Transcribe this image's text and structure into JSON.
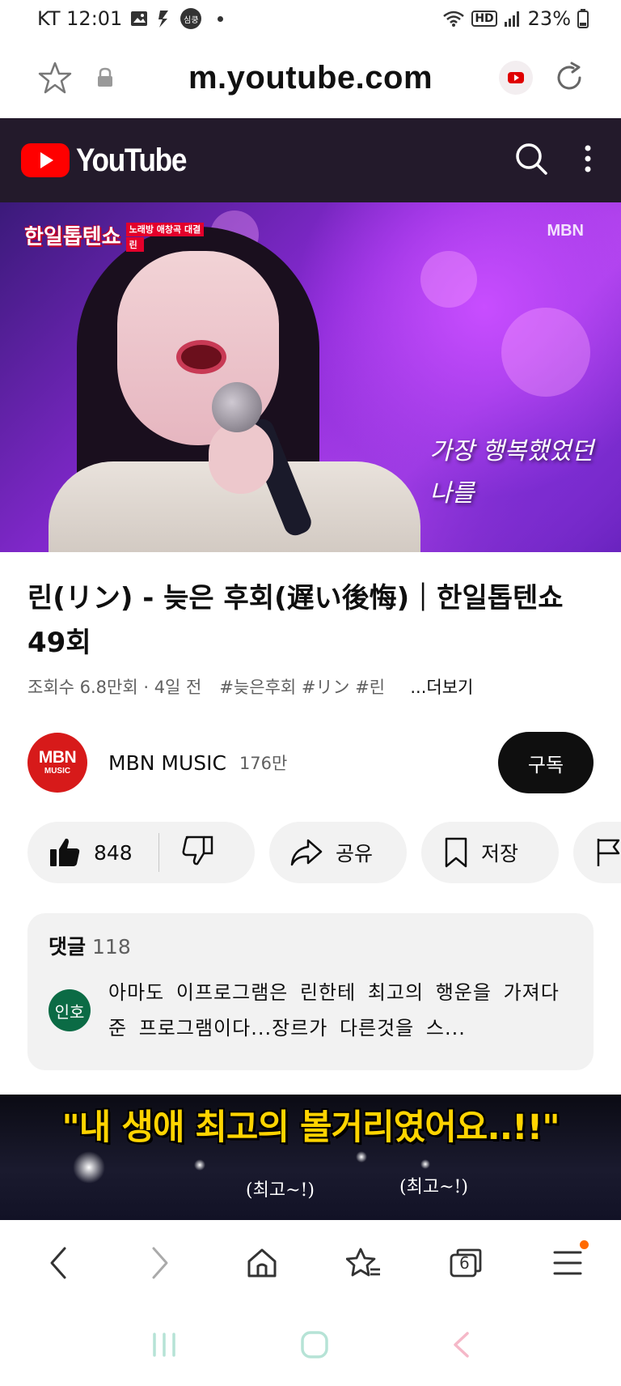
{
  "status_bar": {
    "carrier_time": "KT 12:01",
    "notification_badge": "심쿵",
    "network_label": "HD",
    "battery": "23%"
  },
  "browser": {
    "url": "m.youtube.com"
  },
  "youtube_header": {
    "logo_text": "YouTube"
  },
  "player": {
    "show_logo": "한일톱텐쇼",
    "show_tag": "노래방 애창곡 대결",
    "show_singer": "린",
    "channel_watermark": "MBN",
    "subtitle_line1": "가장 행복했었던",
    "subtitle_line2": "나를"
  },
  "video": {
    "title": "린(リン) - 늦은 후회(遅い後悔)｜한일톱텐쇼 49회",
    "views": "조회수 6.8만회 · 4일 전",
    "hashtags": "#늦은후회 #リン #린",
    "more": "...더보기"
  },
  "channel": {
    "avatar_big": "MBN",
    "avatar_small": "MUSIC",
    "name": "MBN MUSIC",
    "subscribers": "176만",
    "subscribe_label": "구독"
  },
  "actions": {
    "like_count": "848",
    "share_label": "공유",
    "save_label": "저장"
  },
  "comments": {
    "heading": "댓글",
    "count": "118",
    "top_comment_avatar": "인호",
    "top_comment_text": "아마도 이프로그램은 린한테 최고의 행운을 가져다준 프로그램이다...장르가 다른것을 스..."
  },
  "next_video": {
    "caption": "\"내 생애 최고의 볼거리였어요..!!\"",
    "bubble_left": "(최고~!)",
    "bubble_right": "(최고~!)"
  },
  "browser_nav": {
    "tab_count": "6"
  },
  "colors": {
    "youtube_red": "#ff0000",
    "header_bg": "#231a2b",
    "subscribe_bg": "#0f0f0f",
    "pill_bg": "#f2f2f2",
    "notif_dot": "#ff6a00"
  }
}
